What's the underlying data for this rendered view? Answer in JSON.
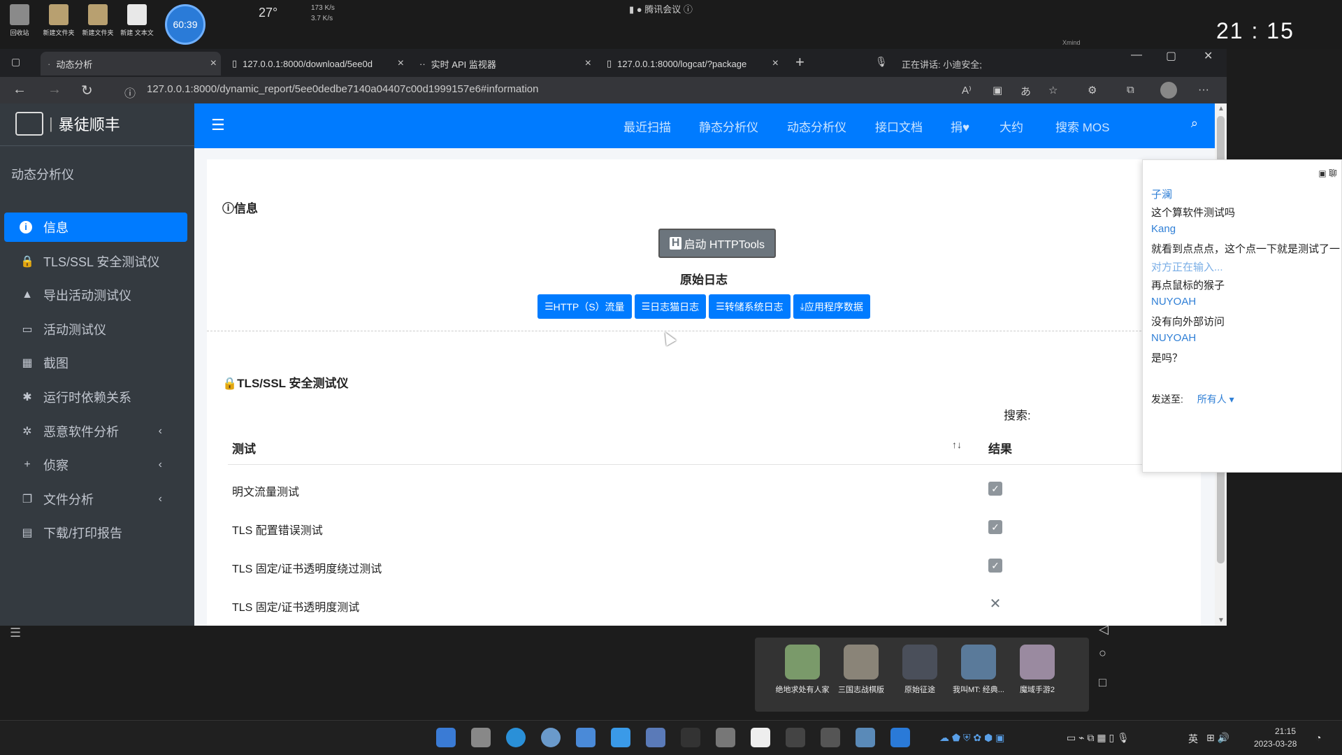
{
  "desktop": {
    "icons": [
      {
        "label": "回收站"
      },
      {
        "label": "新建文件夹"
      },
      {
        "label": "新建文件夹"
      },
      {
        "label": "新建 文本文"
      }
    ],
    "timer": "60:39",
    "weather_temp": "27",
    "net_up": "173 K/s",
    "net_down": "3.7 K/s",
    "meeting_title": "腾讯会议",
    "speaking_text": "正在讲话: 小迪安全;",
    "clock": "21 : 15",
    "xmind": "Xmind"
  },
  "browser": {
    "tabs": [
      {
        "title": "动态分析",
        "active": true
      },
      {
        "title": "127.0.0.1:8000/download/5ee0d",
        "active": false
      },
      {
        "title": "实时 API 监视器",
        "active": false
      },
      {
        "title": "127.0.0.1:8000/logcat/?package",
        "active": false
      }
    ],
    "new_tab": "+",
    "url": "127.0.0.1:8000/dynamic_report/5ee0dedbe7140a04407c00d1999157e6#information"
  },
  "app": {
    "brand": "暴徒顺丰",
    "section_title": "动态分析仪",
    "sidebar_items": [
      {
        "label": "信息",
        "icon": "info-icon",
        "glyph": "i",
        "active": true,
        "chevron": false
      },
      {
        "label": "TLS/SSL 安全测试仪",
        "icon": "lock-icon",
        "glyph": "🔒",
        "active": false,
        "chevron": false
      },
      {
        "label": "导出活动测试仪",
        "icon": "rocket-icon",
        "glyph": "▲",
        "active": false,
        "chevron": false
      },
      {
        "label": "活动测试仪",
        "icon": "id-card-icon",
        "glyph": "▭",
        "active": false,
        "chevron": false
      },
      {
        "label": "截图",
        "icon": "image-icon",
        "glyph": "▦",
        "active": false,
        "chevron": false
      },
      {
        "label": "运行时依赖关系",
        "icon": "runner-icon",
        "glyph": "✱",
        "active": false,
        "chevron": false
      },
      {
        "label": "恶意软件分析",
        "icon": "bug-icon",
        "glyph": "✲",
        "active": false,
        "chevron": true
      },
      {
        "label": "侦察",
        "icon": "plus-icon",
        "glyph": "+",
        "active": false,
        "chevron": true
      },
      {
        "label": "文件分析",
        "icon": "copy-icon",
        "glyph": "❐",
        "active": false,
        "chevron": true
      },
      {
        "label": "下载/打印报告",
        "icon": "print-icon",
        "glyph": "▤",
        "active": false,
        "chevron": false
      }
    ],
    "nav": {
      "links": [
        "最近扫描",
        "静态分析仪",
        "动态分析仪",
        "接口文档",
        "捐♥",
        "大约",
        "搜索 MOS"
      ]
    },
    "info_section": {
      "heading": "信息",
      "http_tools_button": "启动 HTTPTools",
      "raw_log_title": "原始日志",
      "log_buttons": [
        "HTTP（S）流量",
        "日志猫日志",
        "转储系统日志",
        "应用程序数据"
      ]
    },
    "tls_section": {
      "heading": "TLS/SSL 安全测试仪",
      "search_label": "搜索:",
      "col_test": "测试",
      "col_result": "结果",
      "rows": [
        {
          "test": "明文流量测试",
          "result": "pass"
        },
        {
          "test": "TLS 配置错误测试",
          "result": "pass"
        },
        {
          "test": "TLS 固定/证书透明度绕过测试",
          "result": "pass"
        },
        {
          "test": "TLS 固定/证书透明度测试",
          "result": "fail"
        }
      ]
    }
  },
  "chat": {
    "messages": [
      {
        "name": "子澜",
        "text": "这个算软件测试吗"
      },
      {
        "name": "Kang",
        "text": "就看到点点点，这个点一下就是测试了一"
      },
      {
        "typing": "对方正在输入..."
      },
      {
        "text": "再点鼠标的猴子"
      },
      {
        "name": "NUYOAH",
        "text": "没有向外部访问"
      },
      {
        "name": "NUYOAH",
        "text": "是吗？"
      }
    ],
    "send_label": "发送至:",
    "send_to": "所有人"
  },
  "games": [
    "绝地求处有人家",
    "三国志战棋版",
    "原始征途",
    "我叫MT: 经典...",
    "魔域手游2"
  ],
  "taskbar": {
    "ime": "英",
    "time": "21:15",
    "date": "2023-03-28"
  },
  "colors": {
    "primary": "#007bff",
    "sidebar": "#343a40",
    "chat_name": "#2f7fd6"
  }
}
